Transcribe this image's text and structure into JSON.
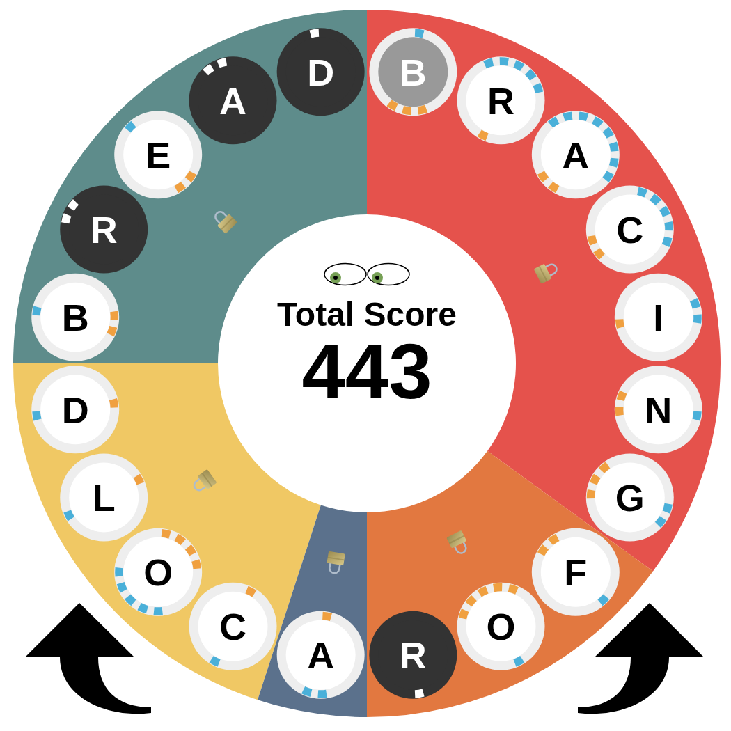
{
  "score": {
    "label": "Total Score",
    "value": "443"
  },
  "left_half": [
    {
      "color": "#5e8c8b",
      "locked": true,
      "tiles": [
        {
          "letter": "B",
          "kind": "open",
          "marks": [
            {
              "kind": "outer"
            },
            {
              "kind": "inner"
            },
            {
              "kind": "inner"
            }
          ]
        },
        {
          "letter": "R",
          "kind": "used",
          "marks": [
            {
              "kind": "outer"
            },
            {
              "kind": "outer"
            }
          ]
        },
        {
          "letter": "E",
          "kind": "open",
          "marks": [
            {
              "kind": "outer"
            },
            {
              "kind": "inner"
            },
            {
              "kind": "inner"
            }
          ]
        },
        {
          "letter": "A",
          "kind": "used",
          "marks": [
            {
              "kind": "outer"
            },
            {
              "kind": "outer"
            }
          ]
        },
        {
          "letter": "D",
          "kind": "used",
          "marks": [
            {
              "kind": "outer"
            }
          ]
        }
      ]
    },
    {
      "color": "#f0c864",
      "locked": true,
      "tiles": [
        {
          "letter": "C",
          "kind": "open",
          "marks": [
            {
              "kind": "outer"
            },
            {
              "kind": "inner"
            }
          ]
        },
        {
          "letter": "O",
          "kind": "open",
          "marks": [
            {
              "kind": "outer"
            },
            {
              "kind": "outer"
            },
            {
              "kind": "outer"
            },
            {
              "kind": "outer"
            },
            {
              "kind": "outer"
            },
            {
              "kind": "inner"
            },
            {
              "kind": "inner"
            },
            {
              "kind": "inner"
            },
            {
              "kind": "inner"
            }
          ]
        },
        {
          "letter": "L",
          "kind": "open",
          "marks": [
            {
              "kind": "outer"
            },
            {
              "kind": "inner"
            }
          ]
        },
        {
          "letter": "D",
          "kind": "open",
          "marks": [
            {
              "kind": "outer"
            },
            {
              "kind": "inner"
            }
          ]
        }
      ]
    },
    {
      "color": "#5b718c",
      "locked": true,
      "tiles": [
        {
          "letter": "A",
          "kind": "open",
          "marks": [
            {
              "kind": "outer"
            },
            {
              "kind": "outer"
            },
            {
              "kind": "inner"
            }
          ]
        }
      ]
    }
  ],
  "right_half": [
    {
      "color": "#e5524c",
      "locked": true,
      "tiles": [
        {
          "letter": "B",
          "kind": "current",
          "marks": [
            {
              "kind": "outer"
            },
            {
              "kind": "inner"
            },
            {
              "kind": "inner"
            },
            {
              "kind": "inner"
            }
          ]
        },
        {
          "letter": "R",
          "kind": "open",
          "marks": [
            {
              "kind": "outer"
            },
            {
              "kind": "outer"
            },
            {
              "kind": "outer"
            },
            {
              "kind": "outer"
            },
            {
              "kind": "outer"
            },
            {
              "kind": "inner"
            }
          ]
        },
        {
          "letter": "A",
          "kind": "open",
          "marks": [
            {
              "kind": "outer"
            },
            {
              "kind": "outer"
            },
            {
              "kind": "outer"
            },
            {
              "kind": "outer"
            },
            {
              "kind": "outer"
            },
            {
              "kind": "outer"
            },
            {
              "kind": "outer"
            },
            {
              "kind": "outer"
            },
            {
              "kind": "inner"
            },
            {
              "kind": "inner"
            }
          ]
        },
        {
          "letter": "C",
          "kind": "open",
          "marks": [
            {
              "kind": "outer"
            },
            {
              "kind": "outer"
            },
            {
              "kind": "outer"
            },
            {
              "kind": "outer"
            },
            {
              "kind": "outer"
            },
            {
              "kind": "inner"
            },
            {
              "kind": "inner"
            }
          ]
        },
        {
          "letter": "I",
          "kind": "open",
          "marks": [
            {
              "kind": "outer"
            },
            {
              "kind": "outer"
            },
            {
              "kind": "inner"
            }
          ]
        },
        {
          "letter": "N",
          "kind": "open",
          "marks": [
            {
              "kind": "outer"
            },
            {
              "kind": "inner"
            },
            {
              "kind": "inner"
            }
          ]
        },
        {
          "letter": "G",
          "kind": "open",
          "marks": [
            {
              "kind": "outer"
            },
            {
              "kind": "outer"
            },
            {
              "kind": "inner"
            },
            {
              "kind": "inner"
            },
            {
              "kind": "inner"
            }
          ]
        }
      ]
    },
    {
      "color": "#e27840",
      "locked": true,
      "tiles": [
        {
          "letter": "F",
          "kind": "open",
          "marks": [
            {
              "kind": "outer"
            },
            {
              "kind": "inner"
            },
            {
              "kind": "inner"
            }
          ]
        },
        {
          "letter": "O",
          "kind": "open",
          "marks": [
            {
              "kind": "outer"
            },
            {
              "kind": "inner"
            },
            {
              "kind": "inner"
            },
            {
              "kind": "inner"
            },
            {
              "kind": "inner"
            },
            {
              "kind": "inner"
            }
          ]
        },
        {
          "letter": "R",
          "kind": "used",
          "marks": [
            {
              "kind": "outer"
            }
          ]
        }
      ]
    }
  ]
}
